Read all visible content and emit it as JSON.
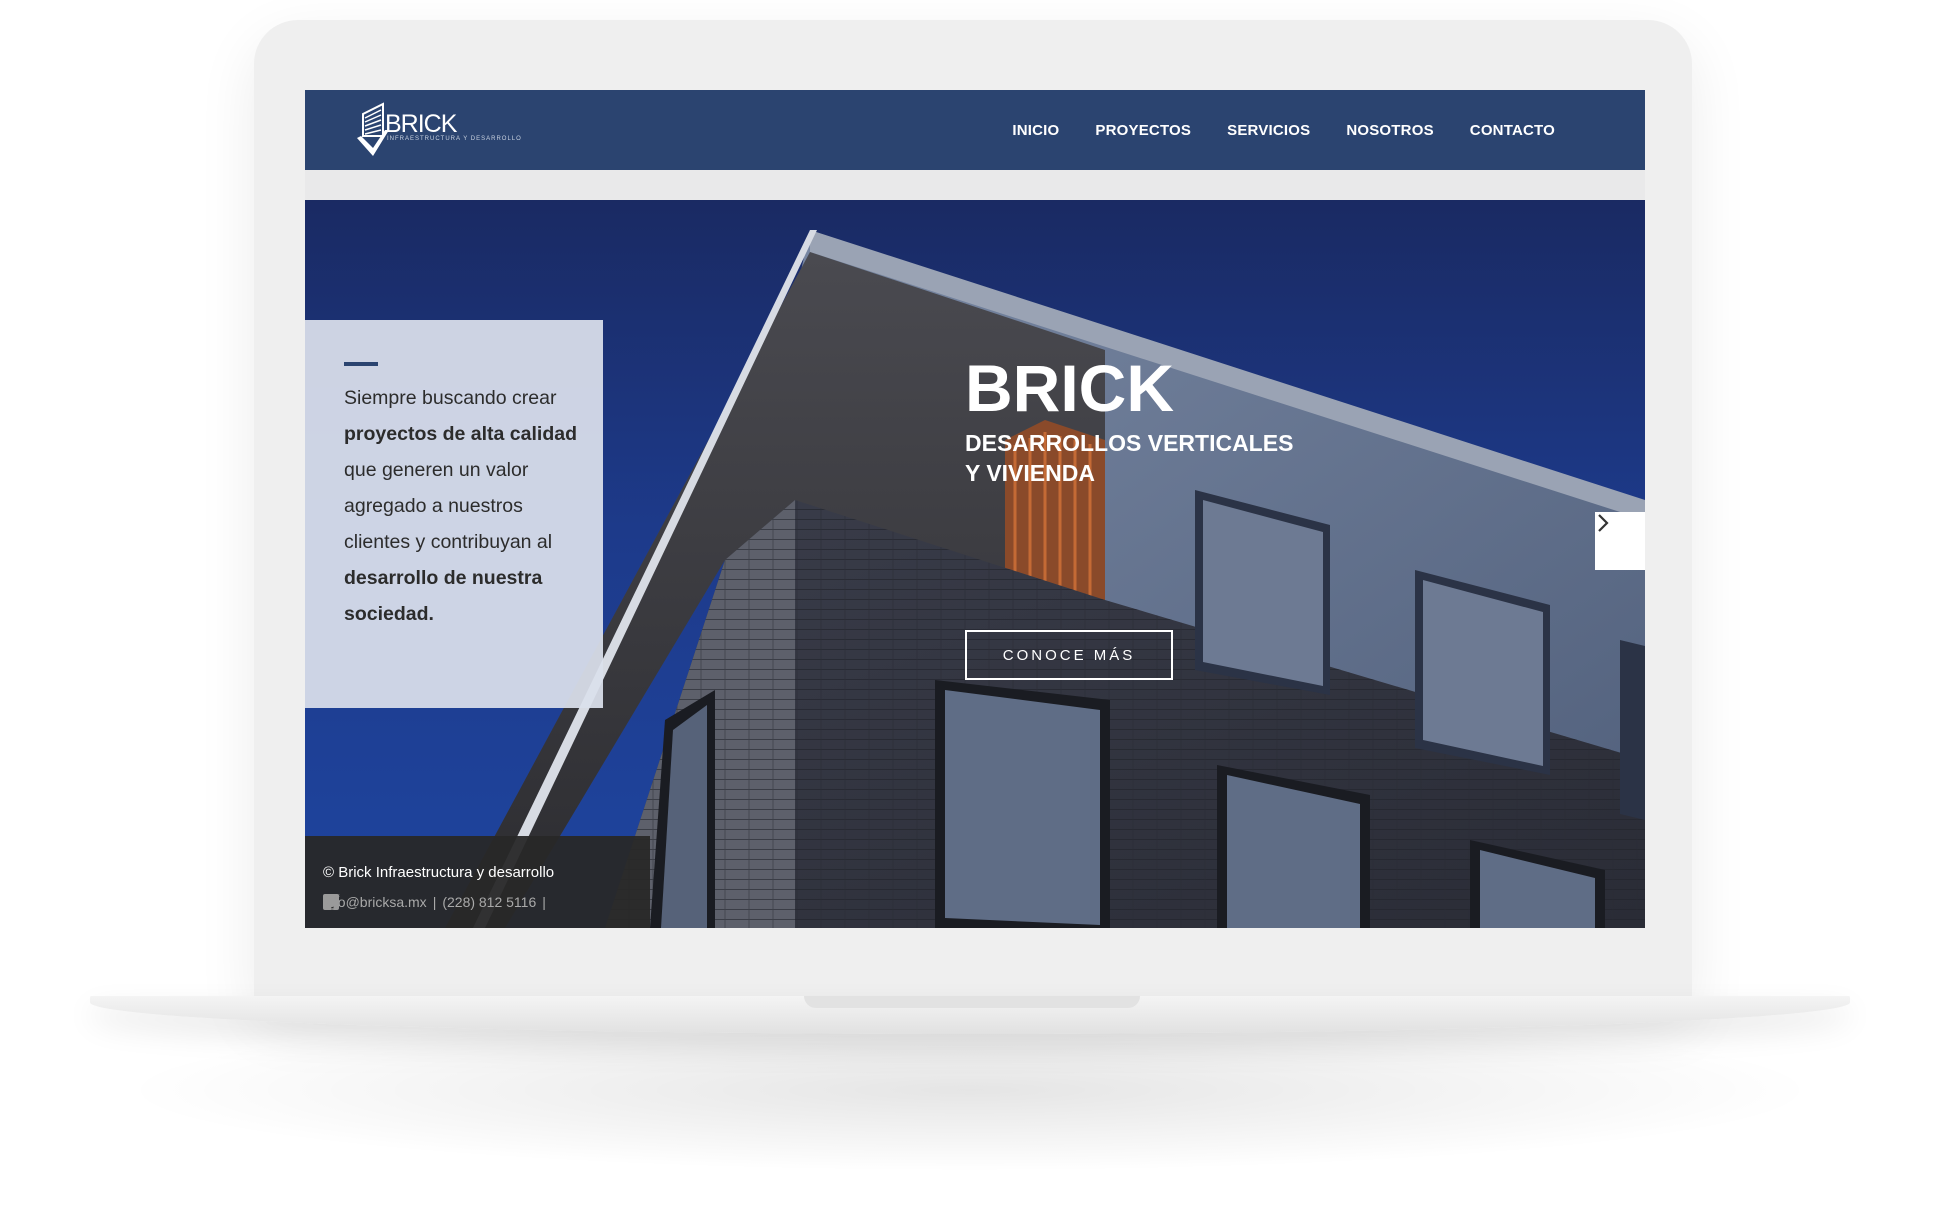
{
  "brand": {
    "logo_text": "BRICK",
    "logo_subtext": "INFRAESTRUCTURA Y DESARROLLO"
  },
  "nav": {
    "items": [
      {
        "label": "INICIO"
      },
      {
        "label": "PROYECTOS"
      },
      {
        "label": "SERVICIOS"
      },
      {
        "label": "NOSOTROS"
      },
      {
        "label": "CONTACTO"
      }
    ]
  },
  "hero": {
    "title": "BRICK",
    "subtitle_line1": "DESARROLLOS VERTICALES",
    "subtitle_line2": "Y VIVIENDA",
    "cta_label": "CONOCE MÁS"
  },
  "quote": {
    "part1": "Siempre buscando crear ",
    "bold1": "proyectos de alta calidad",
    "part2": " que generen un valor agregado a nuestros clientes y contribuyan al ",
    "bold2": "desarrollo de nuestra sociedad."
  },
  "footer": {
    "copyright": "© Brick Infraestructura y desarrollo",
    "email": "info@bricksa.mx",
    "separator1": "|",
    "phone": "(228) 812 5116",
    "separator2": "|"
  },
  "icons": {
    "next": "chevron-right-icon",
    "facebook": "facebook-icon",
    "twitter": "twitter-icon",
    "instagram": "instagram-icon"
  },
  "colors": {
    "nav_bg": "#2b4470",
    "quote_box": "#dae0ec",
    "footer_bg": "#282828"
  }
}
